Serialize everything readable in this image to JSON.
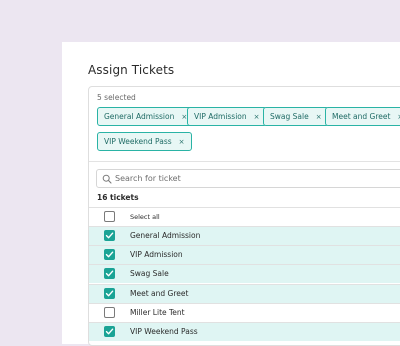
{
  "title": "Assign Tickets",
  "selected_text": "5 selected",
  "chips": [
    {
      "label": "General Admission",
      "remove": "×"
    },
    {
      "label": "VIP Admission",
      "remove": "×"
    },
    {
      "label": "Swag Sale",
      "remove": "×"
    },
    {
      "label": "Meet and Greet",
      "remove": "×"
    },
    {
      "label": "VIP Weekend Pass",
      "remove": "×"
    }
  ],
  "search": {
    "placeholder": "Search for ticket",
    "icon": "search-icon"
  },
  "ticket_count": "16 tickets",
  "select_all_label": "Select all",
  "tickets": [
    {
      "label": "General Admission",
      "checked": true
    },
    {
      "label": "VIP Admission",
      "checked": true
    },
    {
      "label": "Swag Sale",
      "checked": true
    },
    {
      "label": "Meet and Greet",
      "checked": true
    },
    {
      "label": "Miller Lite Tent",
      "checked": false
    },
    {
      "label": "VIP Weekend Pass",
      "checked": true
    }
  ],
  "colors": {
    "accent": "#1aa395",
    "chip_border": "#2ab3a5",
    "chip_bg": "#e8f7f5",
    "row_checked_bg": "#dff5f3",
    "page_bg": "#ece6f1"
  }
}
